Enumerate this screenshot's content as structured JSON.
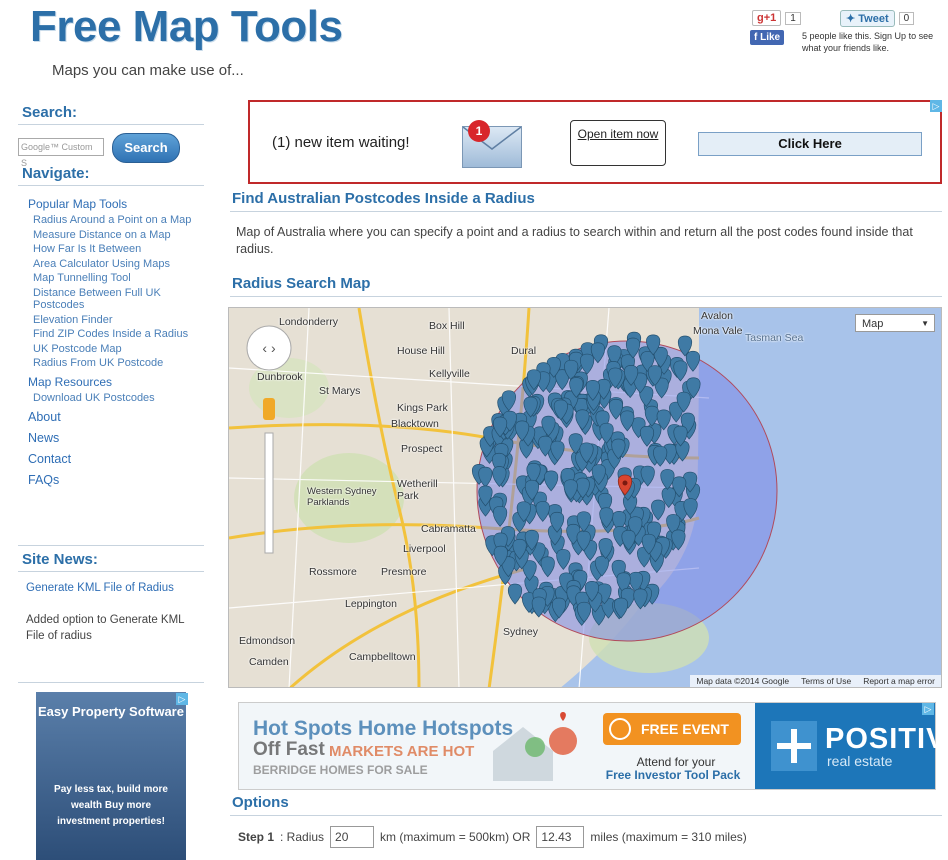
{
  "site": {
    "title": "Free Map Tools",
    "tagline": "Maps you can make use of..."
  },
  "social": {
    "gplus_label": "g+1",
    "gplus_count": "1",
    "tweet_label": "Tweet",
    "tweet_count": "0",
    "like_label": "Like",
    "fb_text": "5 people like this. Sign Up to see what your friends like."
  },
  "sidebar": {
    "search_heading": "Search:",
    "search_placeholder": "Google™ Custom S",
    "search_button": "Search",
    "navigate_heading": "Navigate:",
    "popular_heading": "Popular Map Tools",
    "popular_items": [
      "Radius Around a Point on a Map",
      "Measure Distance on a Map",
      "How Far Is It Between",
      "Area Calculator Using Maps",
      "Map Tunnelling Tool",
      "Distance Between Full UK Postcodes",
      "Elevation Finder",
      "Find ZIP Codes Inside a Radius",
      "UK Postcode Map",
      "Radius From UK Postcode"
    ],
    "resources_heading": "Map Resources",
    "resources_items": [
      "Download UK Postcodes"
    ],
    "top_links": [
      "About",
      "News",
      "Contact",
      "FAQs"
    ],
    "news_heading": "Site News:",
    "news_link": "Generate KML File of Radius",
    "news_text": "Added option to Generate KML File of radius",
    "ad_title": "Easy Property Software",
    "ad_body": "Pay less tax, build more wealth Buy more investment properties!"
  },
  "banner": {
    "message": "(1) new item waiting!",
    "badge": "1",
    "bubble": "Open item now",
    "button": "Click Here"
  },
  "content": {
    "heading": "Find Australian Postcodes Inside a Radius",
    "description": "Map of Australia where you can specify a point and a radius to search within and return all the post codes found inside that radius.",
    "map_heading": "Radius Search Map",
    "options_heading": "Options"
  },
  "map": {
    "type_select": "Map",
    "labels": [
      "Londonderry",
      "Avalon",
      "Box Hill",
      "House Hill",
      "Dural",
      "Mona Vale",
      "Tasman Sea",
      "Dunbrook",
      "Kellyville",
      "St Marys",
      "Kings Park",
      "Blacktown",
      "Prospect",
      "Wetherill Park",
      "Western Sydney Parklands",
      "Cabramatta",
      "Liverpool",
      "Rossmore",
      "Presmore",
      "Leppington",
      "Sydney",
      "Camden",
      "Campbelltown",
      "Edmondson"
    ],
    "attribution": [
      "Map data ©2014 Google",
      "Terms of Use",
      "Report a map error"
    ],
    "colors": {
      "land": "#e6e0d4",
      "sea": "#a8c3ea",
      "radius": "#7a87e6",
      "marker": "#3f7aa5",
      "center": "#d9452f"
    }
  },
  "bottom_ad": {
    "line1": "Hot Spots Home Hotspots",
    "line2": "Off Fast",
    "line3": "MARKETS ARE HOT",
    "line4": "BERRIDGE HOMES FOR SALE",
    "event_button": "FREE EVENT",
    "attend": "Attend for your",
    "attend_bold": "Free Investor Tool Pack",
    "brand": "POSITIVE",
    "brand_sub": "real estate"
  },
  "options": {
    "step": "Step 1",
    "radius_label": ": Radius",
    "radius_km": "20",
    "km_note": "km (maximum = 500km) OR",
    "radius_miles": "12.43",
    "miles_note": "miles (maximum = 310 miles)"
  }
}
